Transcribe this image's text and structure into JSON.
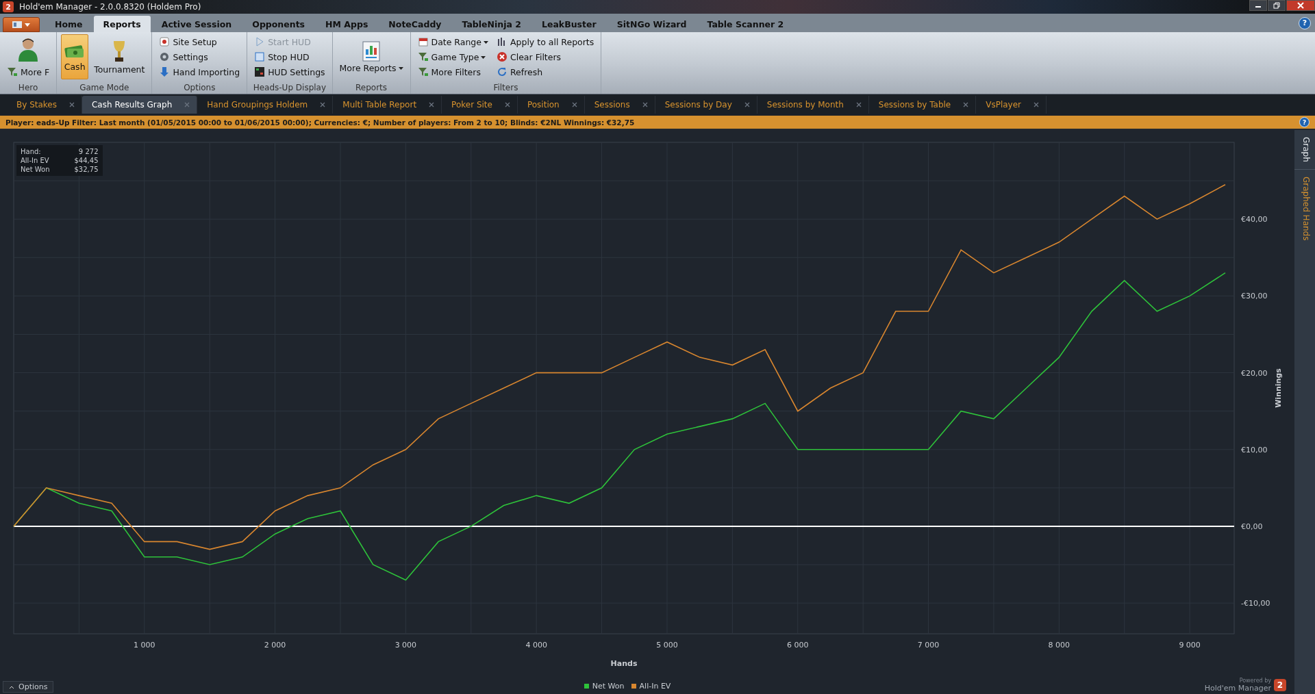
{
  "window": {
    "logo_text": "2",
    "title": "Hold'em Manager - 2.0.0.8320 (Holdem Pro)"
  },
  "menu": [
    {
      "label": "Home",
      "selected": false
    },
    {
      "label": "Reports",
      "selected": true
    },
    {
      "label": "Active Session",
      "selected": false
    },
    {
      "label": "Opponents",
      "selected": false
    },
    {
      "label": "HM Apps",
      "selected": false
    },
    {
      "label": "NoteCaddy",
      "selected": false
    },
    {
      "label": "TableNinja 2",
      "selected": false
    },
    {
      "label": "LeakBuster",
      "selected": false
    },
    {
      "label": "SitNGo Wizard",
      "selected": false
    },
    {
      "label": "Table Scanner 2",
      "selected": false
    }
  ],
  "help": "?",
  "ribbon": [
    {
      "label": "Hero",
      "items": [
        {
          "kind": "avatar"
        },
        {
          "kind": "small",
          "label": "More F"
        }
      ]
    },
    {
      "label": "Game Mode",
      "items": [
        {
          "kind": "large",
          "label": "Cash",
          "selected": true
        },
        {
          "kind": "large",
          "label": "Tournament",
          "selected": false
        }
      ]
    },
    {
      "label": "Options",
      "items": [
        {
          "kind": "small",
          "label": "Site Setup"
        },
        {
          "kind": "small",
          "label": "Settings"
        },
        {
          "kind": "small",
          "label": "Hand Importing"
        }
      ]
    },
    {
      "label": "Heads-Up Display",
      "items": [
        {
          "kind": "small",
          "label": "Start HUD",
          "disabled": true
        },
        {
          "kind": "small",
          "label": "Stop HUD",
          "disabled": false
        },
        {
          "kind": "small",
          "label": "HUD Settings",
          "disabled": false
        }
      ]
    },
    {
      "label": "Reports",
      "items": [
        {
          "kind": "large",
          "label": "More Reports",
          "dropdown": true
        }
      ]
    },
    {
      "label": "Filters",
      "items": [
        {
          "kind": "small",
          "label": "Date Range",
          "dropdown": true
        },
        {
          "kind": "small",
          "label": "Game Type",
          "dropdown": true
        },
        {
          "kind": "small",
          "label": "More Filters",
          "dropdown": false
        },
        {
          "kind": "small",
          "label": "Apply to all Reports",
          "dropdown": false
        },
        {
          "kind": "small",
          "label": "Clear Filters",
          "dropdown": false
        },
        {
          "kind": "small",
          "label": "Refresh",
          "dropdown": false
        }
      ]
    }
  ],
  "doc_tabs": [
    {
      "label": "By Stakes",
      "selected": false
    },
    {
      "label": "Cash Results Graph",
      "selected": true
    },
    {
      "label": "Hand Groupings Holdem",
      "selected": false
    },
    {
      "label": "Multi Table Report",
      "selected": false
    },
    {
      "label": "Poker Site",
      "selected": false
    },
    {
      "label": "Position",
      "selected": false
    },
    {
      "label": "Sessions",
      "selected": false
    },
    {
      "label": "Sessions by Day",
      "selected": false
    },
    {
      "label": "Sessions by Month",
      "selected": false
    },
    {
      "label": "Sessions by Table",
      "selected": false
    },
    {
      "label": "VsPlayer",
      "selected": false
    }
  ],
  "filter_bar": {
    "text": "Player: eads-Up Filter:  Last month (01/05/2015 00:00 to 01/06/2015 00:00); Currencies: €; Number of players: From 2 to 10; Blinds: €2NL  Winnings:  €32,75",
    "help": "?"
  },
  "stats": [
    {
      "label": "Hand:",
      "value": "9 272"
    },
    {
      "label": "All-In EV",
      "value": "$44,45"
    },
    {
      "label": "Net Won",
      "value": "$32,75"
    }
  ],
  "chart_data": {
    "type": "line",
    "grid": true,
    "xlabel": "Hands",
    "ylabel": "Winnings",
    "xlim": [
      0,
      9340
    ],
    "ylim": [
      -14,
      50
    ],
    "x": [
      0,
      250,
      500,
      750,
      1000,
      1250,
      1500,
      1750,
      2000,
      2250,
      2500,
      2750,
      3000,
      3250,
      3500,
      3750,
      4000,
      4250,
      4500,
      4750,
      5000,
      5250,
      5500,
      5750,
      6000,
      6250,
      6500,
      6750,
      7000,
      7250,
      7500,
      7750,
      8000,
      8250,
      8500,
      8750,
      9000,
      9272
    ],
    "xticks": [
      {
        "value": 1000,
        "label": "1 000"
      },
      {
        "value": 2000,
        "label": "2 000"
      },
      {
        "value": 3000,
        "label": "3 000"
      },
      {
        "value": 4000,
        "label": "4 000"
      },
      {
        "value": 5000,
        "label": "5 000"
      },
      {
        "value": 6000,
        "label": "6 000"
      },
      {
        "value": 7000,
        "label": "7 000"
      },
      {
        "value": 8000,
        "label": "8 000"
      },
      {
        "value": 9000,
        "label": "9 000"
      }
    ],
    "yticks": [
      {
        "value": -10,
        "label": "-€10,00"
      },
      {
        "value": 0,
        "label": "€0,00"
      },
      {
        "value": 10,
        "label": "€10,00"
      },
      {
        "value": 20,
        "label": "€20,00"
      },
      {
        "value": 30,
        "label": "€30,00"
      },
      {
        "value": 40,
        "label": "€40,00"
      }
    ],
    "series": [
      {
        "name": "Net Won",
        "color": "#2ec23a",
        "values": [
          0,
          5,
          3,
          2,
          -4,
          -4,
          -5,
          -4,
          -1,
          1,
          2,
          -5,
          -7,
          -2,
          0,
          2.7,
          4,
          3,
          5,
          10,
          12,
          13,
          14,
          16,
          10,
          10,
          10,
          10,
          10,
          15,
          14,
          18,
          22,
          28,
          32,
          28,
          30,
          33
        ]
      },
      {
        "name": "All-In EV",
        "color": "#d8862f",
        "values": [
          0,
          5,
          4,
          3,
          -2,
          -2,
          -3,
          -2,
          2,
          4,
          5,
          8,
          10,
          14,
          16,
          18,
          20,
          20,
          20,
          22,
          24,
          22,
          21,
          23,
          15,
          18,
          20,
          28,
          28,
          36,
          33,
          35,
          37,
          40,
          43,
          40,
          42,
          44.5
        ]
      }
    ]
  },
  "side_tabs": [
    {
      "label": "Graph",
      "selected": true
    },
    {
      "label": "Graphed Hands",
      "selected": false
    }
  ],
  "options_button": "Options",
  "brand": {
    "powered": "Powered by",
    "name": "Hold'em Manager",
    "logo_text": "2"
  }
}
